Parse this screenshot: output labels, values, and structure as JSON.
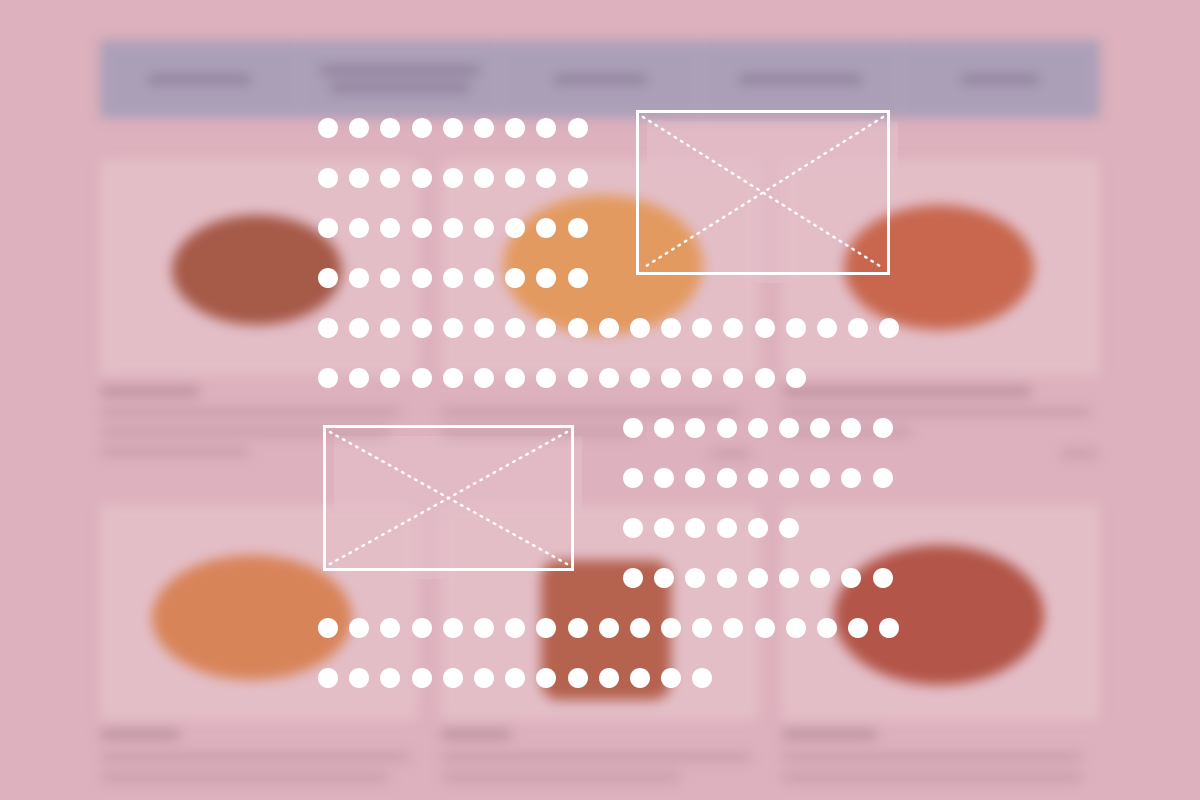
{
  "background": {
    "page_color": "#ddb1bd",
    "nav_color": "#ab9fb8",
    "nav_item_count": 5,
    "cards": [
      {
        "bread_color": "#a65a48"
      },
      {
        "bread_color": "#e39a60"
      },
      {
        "bread_color": "#c8674e"
      },
      {
        "bread_color": "#d88459"
      },
      {
        "bread_color": "#b5624e"
      },
      {
        "bread_color": "#b35548"
      }
    ]
  },
  "placeholders": {
    "text_dot_color": "#ffffff",
    "images": [
      {
        "name": "image-placeholder-top"
      },
      {
        "name": "image-placeholder-bottom"
      }
    ]
  }
}
